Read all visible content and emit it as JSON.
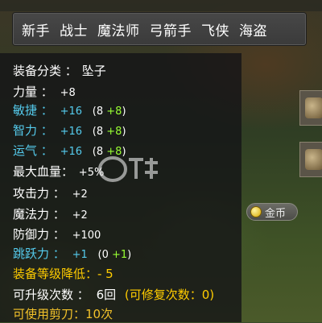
{
  "jobs": [
    "新手",
    "战士",
    "魔法师",
    "弓箭手",
    "飞侠",
    "海盗"
  ],
  "item": {
    "category_label": "装备分类 ：",
    "category_value": "坠子",
    "stats": [
      {
        "label": "力量 ：",
        "value": "+8",
        "extra": "",
        "extra_bonus": "",
        "extra_close": "",
        "color": "white"
      },
      {
        "label": "敏捷 ：",
        "value": "+16",
        "extra": "(8 ",
        "extra_bonus": "+8",
        "extra_close": ")",
        "color": "cyan"
      },
      {
        "label": "智力 ：",
        "value": "+16",
        "extra": "(8 ",
        "extra_bonus": "+8",
        "extra_close": ")",
        "color": "cyan"
      },
      {
        "label": "运气 ：",
        "value": "+16",
        "extra": "(8 ",
        "extra_bonus": "+8",
        "extra_close": ")",
        "color": "cyan"
      },
      {
        "label": "最大血量：",
        "value": "+5%",
        "extra": "",
        "extra_bonus": "",
        "extra_close": "",
        "color": "white"
      },
      {
        "label": "攻击力 ：",
        "value": "+2",
        "extra": "",
        "extra_bonus": "",
        "extra_close": "",
        "color": "white"
      },
      {
        "label": "魔法力 ：",
        "value": "+2",
        "extra": "",
        "extra_bonus": "",
        "extra_close": "",
        "color": "white"
      },
      {
        "label": "防御力 ：",
        "value": "+100",
        "extra": "",
        "extra_bonus": "",
        "extra_close": "",
        "color": "white"
      },
      {
        "label": "跳跃力 ：",
        "value": "+1",
        "extra": "(0 ",
        "extra_bonus": "+1",
        "extra_close": ")",
        "color": "cyan"
      }
    ],
    "level_reduction": "装备等级降低：- 5",
    "upgrade_label": "可升级次数 ：",
    "upgrade_value": "6回",
    "repair_text": "(可修复次数：0)",
    "scissors_text": "可使用剪刀：10次"
  },
  "side": {
    "coin_label": "金币"
  },
  "colors": {
    "cyan": "#55ccee",
    "green": "#99ff33",
    "yellow": "#ffcc00",
    "gold": "#f3c22a"
  }
}
